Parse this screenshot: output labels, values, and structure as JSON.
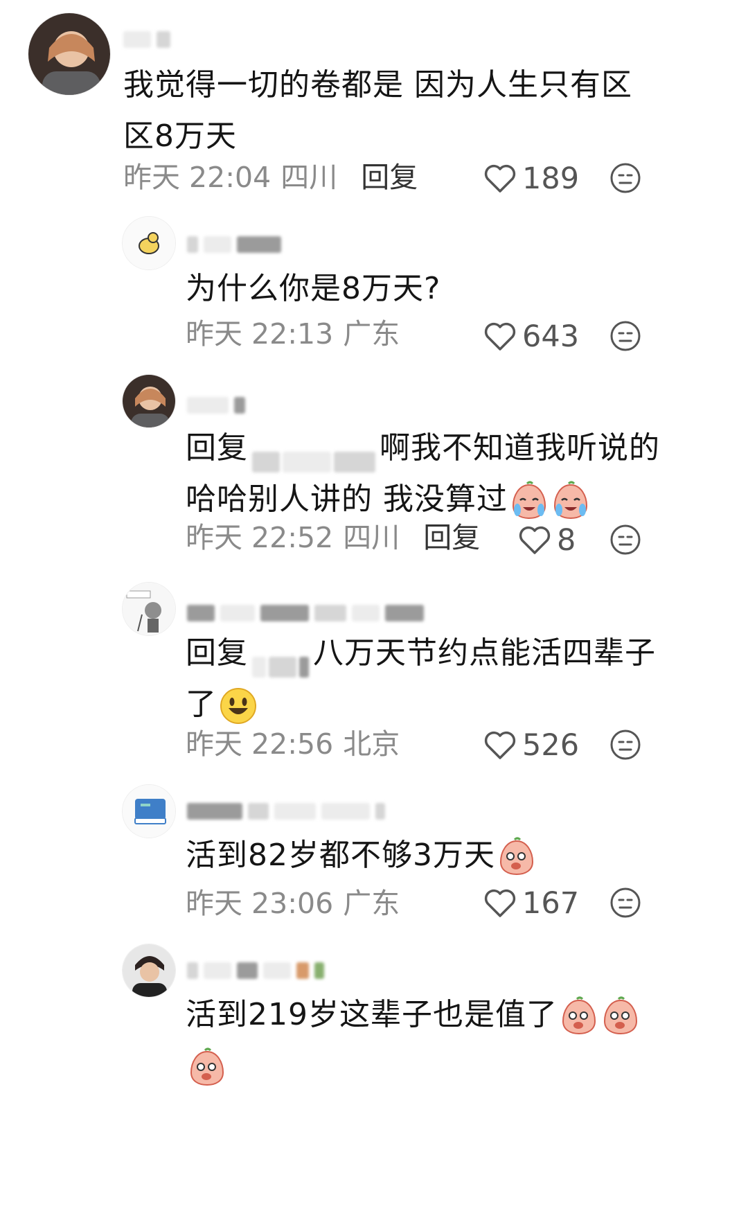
{
  "comments": [
    {
      "text": "我觉得一切的卷都是 因为人生只有区区8万天",
      "time": "昨天 22:04",
      "location": "四川",
      "reply_label": "回复",
      "likes": "189"
    },
    {
      "text": "为什么你是8万天?",
      "time": "昨天 22:13",
      "location": "广东",
      "likes": "643"
    },
    {
      "prefix": "回复",
      "text": "啊我不知道我听说的 哈哈别人讲的 我没算过",
      "time": "昨天 22:52",
      "location": "四川",
      "reply_label": "回复",
      "likes": "8"
    },
    {
      "prefix": "回复",
      "text": "八万天节约点能活四辈子了",
      "time": "昨天 22:56",
      "location": "北京",
      "likes": "526"
    },
    {
      "text": "活到82岁都不够3万天",
      "time": "昨天 23:06",
      "location": "广东",
      "likes": "167"
    },
    {
      "text": "活到219岁这辈子也是值了"
    }
  ],
  "icons": {
    "like": "heart-outline-icon",
    "dislike": "meh-face-icon"
  },
  "colors": {
    "text": "#151515",
    "meta": "#8a8a8a",
    "icon": "#555555"
  }
}
